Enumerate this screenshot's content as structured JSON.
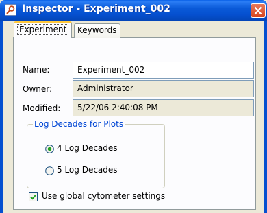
{
  "window": {
    "title": "Inspector - Experiment_002",
    "title_color": "#0550d0",
    "icon": "inspector-icon",
    "close_icon": "close-icon"
  },
  "tabs": [
    {
      "label": "Experiment",
      "selected": true
    },
    {
      "label": "Keywords",
      "selected": false
    }
  ],
  "fields": {
    "name": {
      "label": "Name:",
      "value": "Experiment_002"
    },
    "owner": {
      "label": "Owner:",
      "value": "Administrator"
    },
    "modified": {
      "label": "Modified:",
      "value": "5/22/06 2:40:08 PM"
    }
  },
  "log_decades": {
    "legend": "Log Decades for Plots",
    "options": [
      {
        "label": "4 Log Decades",
        "selected": true
      },
      {
        "label": "5 Log Decades",
        "selected": false
      }
    ]
  },
  "use_global": {
    "label": "Use global cytometer settings",
    "checked": true
  },
  "colors": {
    "accent": "#0046d5",
    "tab_highlight": "#ffc83c",
    "close": "#d6451e"
  }
}
